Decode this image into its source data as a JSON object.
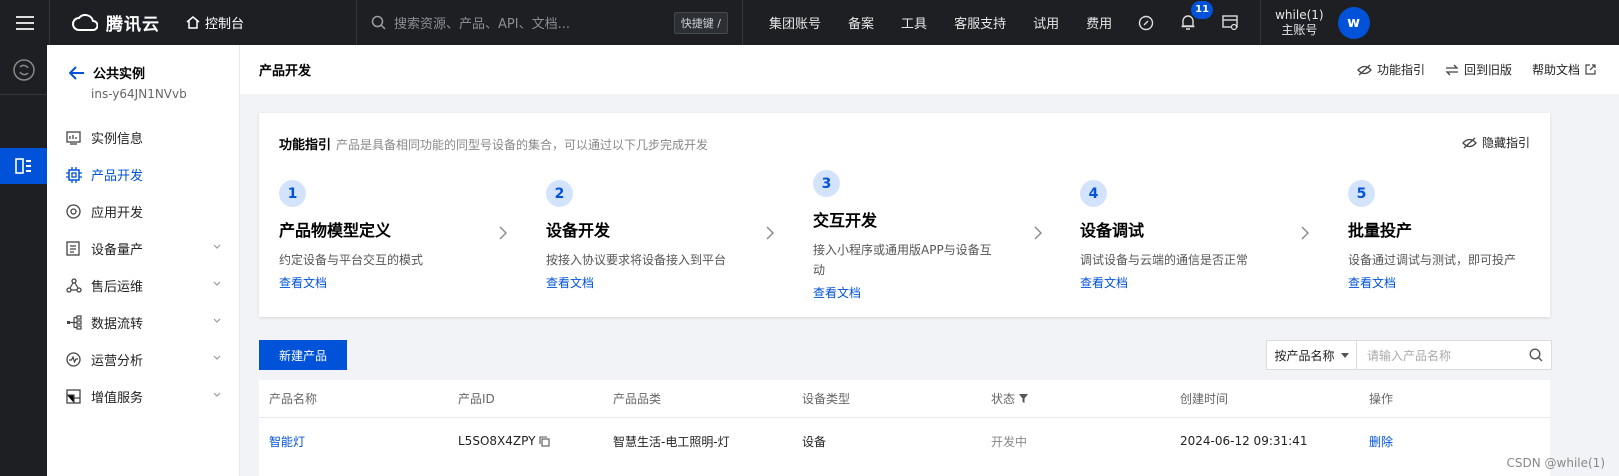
{
  "topbar": {
    "brand": "腾讯云",
    "console": "控制台",
    "search_placeholder": "搜索资源、产品、API、文档...",
    "shortcut": "快捷键 /",
    "nav": [
      "集团账号",
      "备案",
      "工具",
      "客服支持",
      "试用",
      "费用"
    ],
    "notification_count": "11",
    "user_name": "while(1)",
    "user_role": "主账号",
    "avatar_letter": "w"
  },
  "sidebar": {
    "back_title": "公共实例",
    "instance_id": "ins-y64JN1NVvb",
    "items": [
      {
        "label": "实例信息",
        "icon": "monitor-icon"
      },
      {
        "label": "产品开发",
        "icon": "chip-icon",
        "active": true
      },
      {
        "label": "应用开发",
        "icon": "circle-gear-icon"
      },
      {
        "label": "设备量产",
        "icon": "list-doc-icon",
        "expandable": true
      },
      {
        "label": "售后运维",
        "icon": "nodes-icon",
        "expandable": true
      },
      {
        "label": "数据流转",
        "icon": "flow-icon",
        "expandable": true
      },
      {
        "label": "运营分析",
        "icon": "pulse-icon",
        "expandable": true
      },
      {
        "label": "增值服务",
        "icon": "grid-icon",
        "expandable": true
      }
    ]
  },
  "header": {
    "title": "产品开发",
    "links": [
      "功能指引",
      "回到旧版",
      "帮助文档"
    ]
  },
  "guide": {
    "title": "功能指引",
    "desc": "产品是具备相同功能的同型号设备的集合，可以通过以下几步完成开发",
    "hide": "隐藏指引",
    "steps": [
      {
        "num": "1",
        "title": "产品物模型定义",
        "desc": "约定设备与平台交互的模式",
        "link": "查看文档"
      },
      {
        "num": "2",
        "title": "设备开发",
        "desc": "按接入协议要求将设备接入到平台",
        "link": "查看文档"
      },
      {
        "num": "3",
        "title": "交互开发",
        "desc": "接入小程序或通用版APP与设备互动",
        "link": "查看文档"
      },
      {
        "num": "4",
        "title": "设备调试",
        "desc": "调试设备与云端的通信是否正常",
        "link": "查看文档"
      },
      {
        "num": "5",
        "title": "批量投产",
        "desc": "设备通过调试与测试，即可投产",
        "link": "查看文档"
      }
    ]
  },
  "toolbar": {
    "new_button": "新建产品",
    "filter_select": "按产品名称",
    "filter_placeholder": "请输入产品名称"
  },
  "table": {
    "columns": [
      "产品名称",
      "产品ID",
      "产品品类",
      "设备类型",
      "状态",
      "创建时间",
      "操作"
    ],
    "rows": [
      [
        "智能灯",
        "L5SO8X4ZPY",
        "智慧生活-电工照明-灯",
        "设备",
        "开发中",
        "2024-06-12 09:31:41",
        "删除"
      ]
    ]
  },
  "watermark": "CSDN @while(1)",
  "colors": {
    "accent": "#0052d9",
    "topbar_bg": "#1d1f23",
    "page_bg": "#f2f3f6"
  }
}
